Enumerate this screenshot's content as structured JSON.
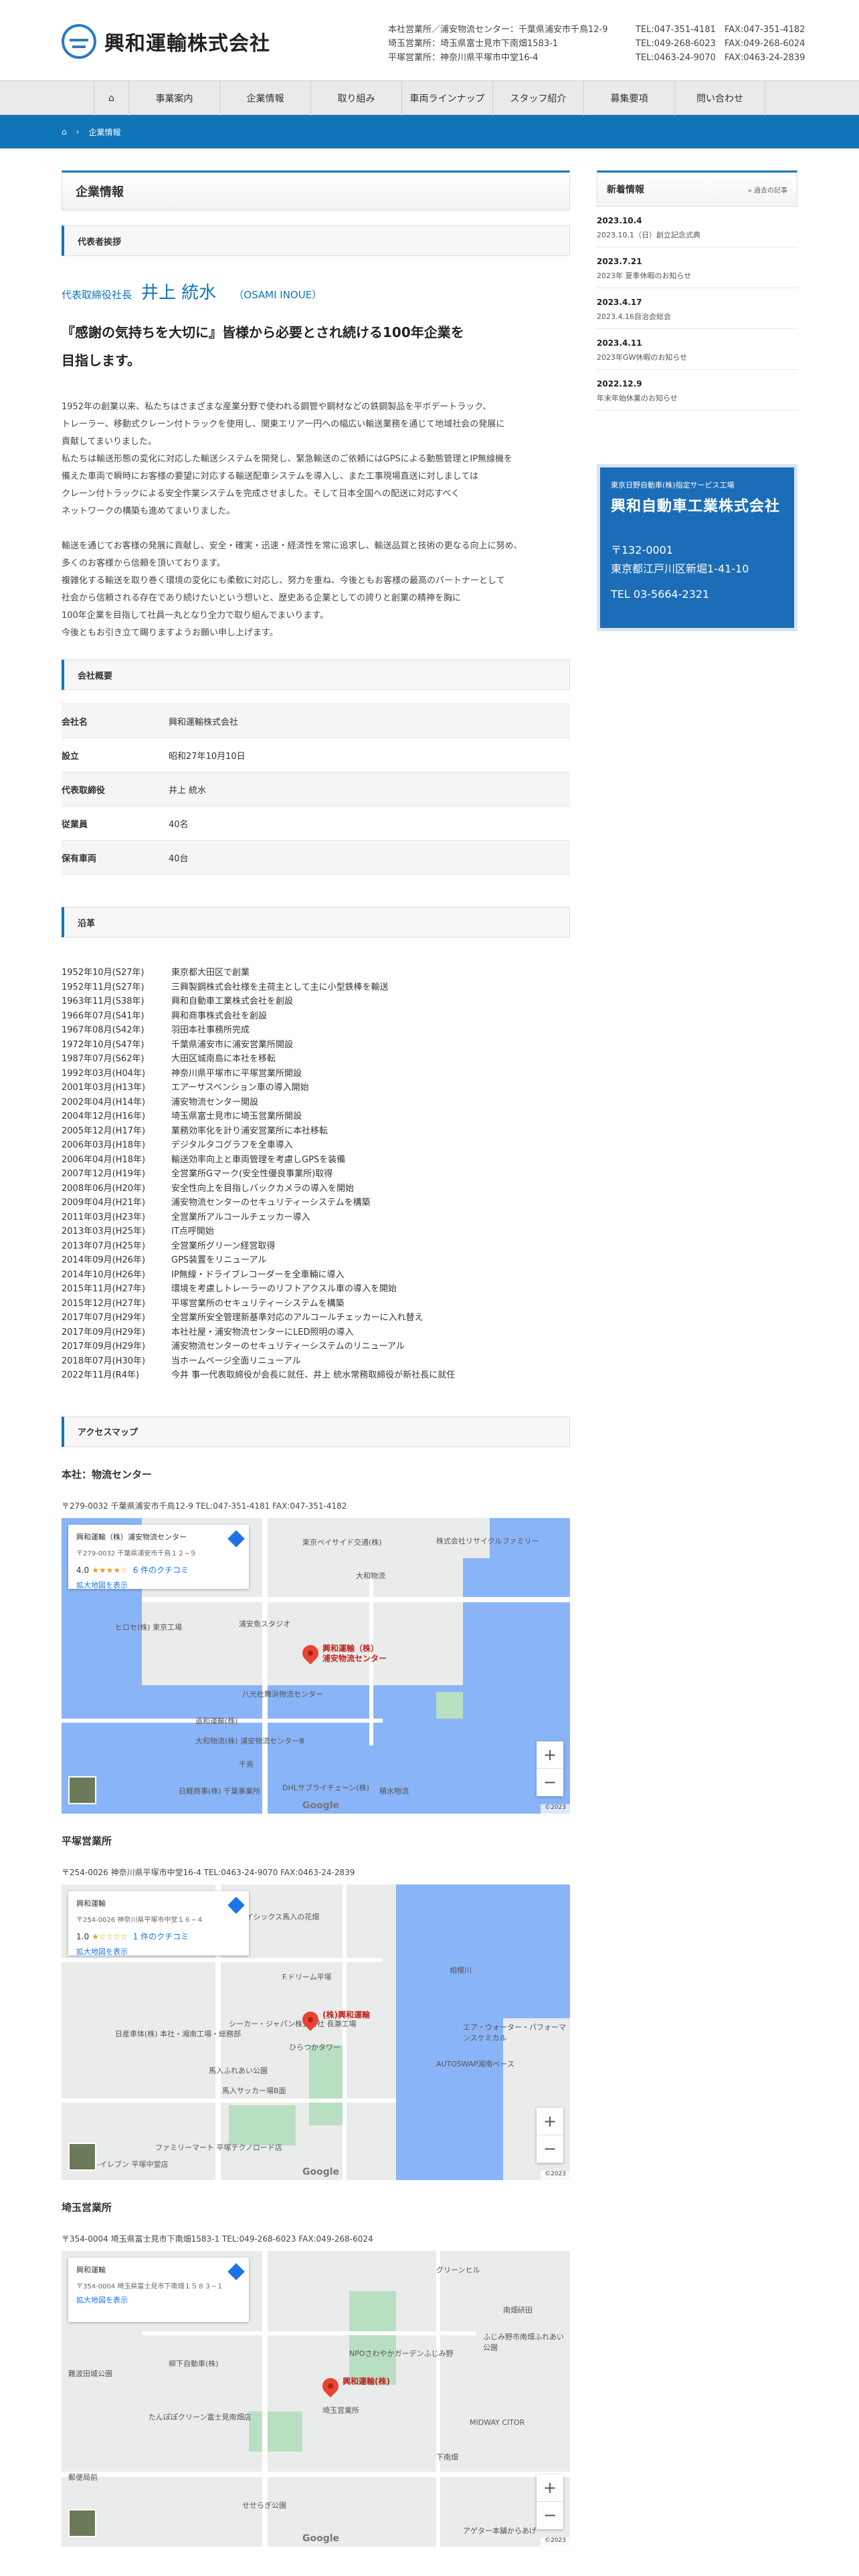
{
  "header": {
    "company": "興和運輸株式会社",
    "offices": [
      {
        "name": "本社営業所／浦安物流センター：千葉県浦安市千鳥12-9",
        "tel": "TEL:047-351-4181　FAX:047-351-4182"
      },
      {
        "name": "埼玉営業所：埼玉県富士見市下南畑1583-1",
        "tel": "TEL:049-268-6023　FAX:049-268-6024"
      },
      {
        "name": "平塚営業所：神奈川県平塚市中堂16-4",
        "tel": "TEL:0463-24-9070　FAX:0463-24-2839"
      }
    ]
  },
  "nav": [
    "事業案内",
    "企業情報",
    "取り組み",
    "車両ラインナップ",
    "スタッフ紹介",
    "募集要項",
    "問い合わせ"
  ],
  "breadcrumb": {
    "current": "企業情報"
  },
  "page": {
    "title": "企業情報",
    "greeting_heading": "代表者挨拶",
    "rep_role": "代表取締役社長",
    "rep_name": "井上 統水",
    "rep_reading": "（OSAMI INOUE）",
    "lead_1": "『感謝の気持ちを大切に』皆様から必要とされ続ける100年企業を",
    "lead_2": "目指します。",
    "para_1": [
      "1952年の創業以来、私たちはさまざまな産業分野で使われる鋼管や鋼材などの鉄鋼製品を平ボデートラック、",
      "トレーラー、移動式クレーン付トラックを使用し、関東エリア一円への幅広い輸送業務を通じて地域社会の発展に",
      "貢献してまいりました。",
      "私たちは輸送形態の変化に対応した輸送システムを開発し、緊急輸送のご依頼にはGPSによる動態管理とIP無線機を",
      "備えた車両で瞬時にお客様の要望に対応する輸送配車システムを導入し、また工事現場直送に対しましては",
      "クレーン付トラックによる安全作業システムを完成させました。そして日本全国への配送に対応すべく",
      "ネットワークの構築も進めてまいりました。"
    ],
    "para_2": [
      "輸送を通じてお客様の発展に貢献し、安全・確実・迅速・経済性を常に追求し、輸送品質と技術の更なる向上に努め、",
      "多くのお客様から信頼を頂いております。",
      "複雑化する輸送を取り巻く環境の変化にも柔軟に対応し、努力を重ね、今後ともお客様の最高のパートナーとして",
      "社会から信頼される存在であり続けたいという想いと、歴史ある企業としての誇りと創業の精神を胸に",
      "100年企業を目指して社員一丸となり全力で取り組んでまいります。",
      "今後ともお引き立て賜りますようお願い申し上げます。"
    ],
    "overview_heading": "会社概要",
    "overview": [
      {
        "k": "会社名",
        "v": "興和運輸株式会社"
      },
      {
        "k": "設立",
        "v": "昭和27年10月10日"
      },
      {
        "k": "代表取締役",
        "v": "井上 統水"
      },
      {
        "k": "従業員",
        "v": "40名"
      },
      {
        "k": "保有車両",
        "v": "40台"
      }
    ],
    "history_heading": "沿革",
    "history": [
      {
        "d": "1952年10月(S27年)",
        "t": "東京都大田区で創業"
      },
      {
        "d": "1952年11月(S27年)",
        "t": "三興製鋼株式会社様を主荷主として主に小型鉄棒を輸送"
      },
      {
        "d": "1963年11月(S38年)",
        "t": "興和自動車工業株式会社を創設"
      },
      {
        "d": "1966年07月(S41年)",
        "t": "興和商事株式会社を創設"
      },
      {
        "d": "1967年08月(S42年)",
        "t": "羽田本社事務所完成"
      },
      {
        "d": "1972年10月(S47年)",
        "t": "千葉県浦安市に浦安営業所開設"
      },
      {
        "d": "1987年07月(S62年)",
        "t": "大田区城南島に本社を移転"
      },
      {
        "d": "1992年03月(H04年)",
        "t": "神奈川県平塚市に平塚営業所開設"
      },
      {
        "d": "2001年03月(H13年)",
        "t": "エアーサスペンション車の導入開始"
      },
      {
        "d": "2002年04月(H14年)",
        "t": "浦安物流センター開設"
      },
      {
        "d": "2004年12月(H16年)",
        "t": "埼玉県富士見市に埼玉営業所開設"
      },
      {
        "d": "2005年12月(H17年)",
        "t": "業務効率化を計り浦安営業所に本社移転"
      },
      {
        "d": "2006年03月(H18年)",
        "t": "デジタルタコグラフを全車導入"
      },
      {
        "d": "2006年04月(H18年)",
        "t": "輸送効率向上と車両管理を考慮しGPSを装備"
      },
      {
        "d": "2007年12月(H19年)",
        "t": "全営業所Gマーク(安全性優良事業所)取得"
      },
      {
        "d": "2008年06月(H20年)",
        "t": "安全性向上を目指しバックカメラの導入を開始"
      },
      {
        "d": "2009年04月(H21年)",
        "t": "浦安物流センターのセキュリティーシステムを構築"
      },
      {
        "d": "2011年03月(H23年)",
        "t": "全営業所アルコールチェッカー導入"
      },
      {
        "d": "2013年03月(H25年)",
        "t": "IT点呼開始"
      },
      {
        "d": "2013年07月(H25年)",
        "t": "全営業所グリーン経営取得"
      },
      {
        "d": "2014年09月(H26年)",
        "t": "GPS装置をリニューアル"
      },
      {
        "d": "2014年10月(H26年)",
        "t": "IP無線・ドライブレコーダーを全車輛に導入"
      },
      {
        "d": "2015年11月(H27年)",
        "t": "環境を考慮しトレーラーのリフトアクスル車の導入を開始"
      },
      {
        "d": "2015年12月(H27年)",
        "t": "平塚営業所のセキュリティーシステムを構築"
      },
      {
        "d": "2017年07月(H29年)",
        "t": "全営業所安全管理新基準対応のアルコールチェッカーに入れ替え"
      },
      {
        "d": "2017年09月(H29年)",
        "t": "本社社屋・浦安物流センターにLED照明の導入"
      },
      {
        "d": "2017年09月(H29年)",
        "t": "浦安物流センターのセキュリティーシステムのリニューアル"
      },
      {
        "d": "2018年07月(H30年)",
        "t": "当ホームページ全面リニューアル"
      },
      {
        "d": "2022年11月(R4年)",
        "t": "今井 事一代表取締役が会長に就任、井上 統水常務取締役が新社長に就任"
      }
    ],
    "access_heading": "アクセスマップ",
    "maps": [
      {
        "title": "本社：物流センター",
        "addr": "〒279-0032 千葉県浦安市千鳥12-9 TEL:047-351-4181 FAX:047-351-4182",
        "card_name": "興和運輸（株）浦安物流センター",
        "card_addr": "〒279-0032 千葉県浦安市千鳥１２−９",
        "rating": "4.0",
        "stars": "★★★★☆",
        "reviews": "6 件のクチコミ",
        "link": "拡大地図を表示",
        "pin": "興和運輸（株）\n浦安物流センター",
        "labels": [
          "東京ベイサイド交通(株)",
          "株式会社リサイクルファミリー",
          "大和物流",
          "ヒロセ(株) 東京工場",
          "浦安魚スタジオ",
          "八光社舞浜物流センター",
          "道和運輸(株)",
          "大和物流(株) 浦安物流センターⅢ",
          "千鳥",
          "日軽商事(株) 千葉事業所",
          "DHLサプライチェーン(株)",
          "積水物流"
        ]
      },
      {
        "title": "平塚営業所",
        "addr": "〒254-0026 神奈川県平塚市中堂16-4 TEL:0463-24-9070 FAX:0463-24-2839",
        "card_name": "興和運輸",
        "card_addr": "〒254-0026 神奈川県平塚市中堂１６−４",
        "rating": "1.0",
        "stars": "★☆☆☆☆",
        "reviews": "1 件のクチコミ",
        "link": "拡大地図を表示",
        "pin": "(株)興和運輸",
        "labels": [
          "長瀞 イシックス馬入の花畑",
          "F.ドリーム平塚",
          "シーカー・ジャパン株式会社 長瀞工場",
          "日産車体(株) 本社・湘南工場・総務部",
          "ひらつかタワー",
          "馬入ふれあい公園",
          "馬入サッカー場B面",
          "AUTOSWAP湘南ベース",
          "エア・ウォーター・パフォーマンスケミカル",
          "ファミリーマート 平塚テクノロード店",
          "セブン-イレブン 平塚中堂店",
          "相模川"
        ]
      },
      {
        "title": "埼玉営業所",
        "addr": "〒354-0004 埼玉県富士見市下南畑1583-1 TEL:049-268-6023 FAX:049-268-6024",
        "card_name": "興和運輸",
        "card_addr": "〒354-0004 埼玉県富士見市下南畑１５８３−１",
        "rating": "",
        "stars": "",
        "reviews": "",
        "link": "拡大地図を表示",
        "pin": "興和運輸(株)",
        "labels": [
          "グリーンヒル",
          "南畑研田",
          "ふじみ野市南畑ふれあい公園",
          "NPOさわやかガーデンふじみ野",
          "柳下自動車(株)",
          "難波田城公園",
          "たんぽぽクリーン富士見南畑店",
          "埼玉営業所",
          "MIDWAY CITOR",
          "下南畑",
          "せせらぎ公園",
          "アゲター本舗からあげ",
          "郵便局前"
        ]
      }
    ]
  },
  "sidebar": {
    "news_title": "新着情報",
    "news_link": "過去の記事",
    "news": [
      {
        "d": "2023.10.4",
        "t": "2023.10.1（日）創立記念式典"
      },
      {
        "d": "2023.7.21",
        "t": "2023年 夏季休暇のお知らせ"
      },
      {
        "d": "2023.4.17",
        "t": "2023.4.16自治会総会"
      },
      {
        "d": "2023.4.11",
        "t": "2023年GW休暇のお知らせ"
      },
      {
        "d": "2022.12.9",
        "t": "年末年始休業のお知らせ"
      }
    ],
    "banner": {
      "sub": "東京日野自動車(株)指定サービス工場",
      "name": "興和自動車工業株式会社",
      "zip": "〒132-0001",
      "addr": "東京都江戸川区新堀1-41-10",
      "tel": "TEL 03-5664-2321"
    }
  },
  "colors": {
    "accent": "#0f75b8",
    "water": "#8ab4f8",
    "pin": "#ea4335"
  }
}
